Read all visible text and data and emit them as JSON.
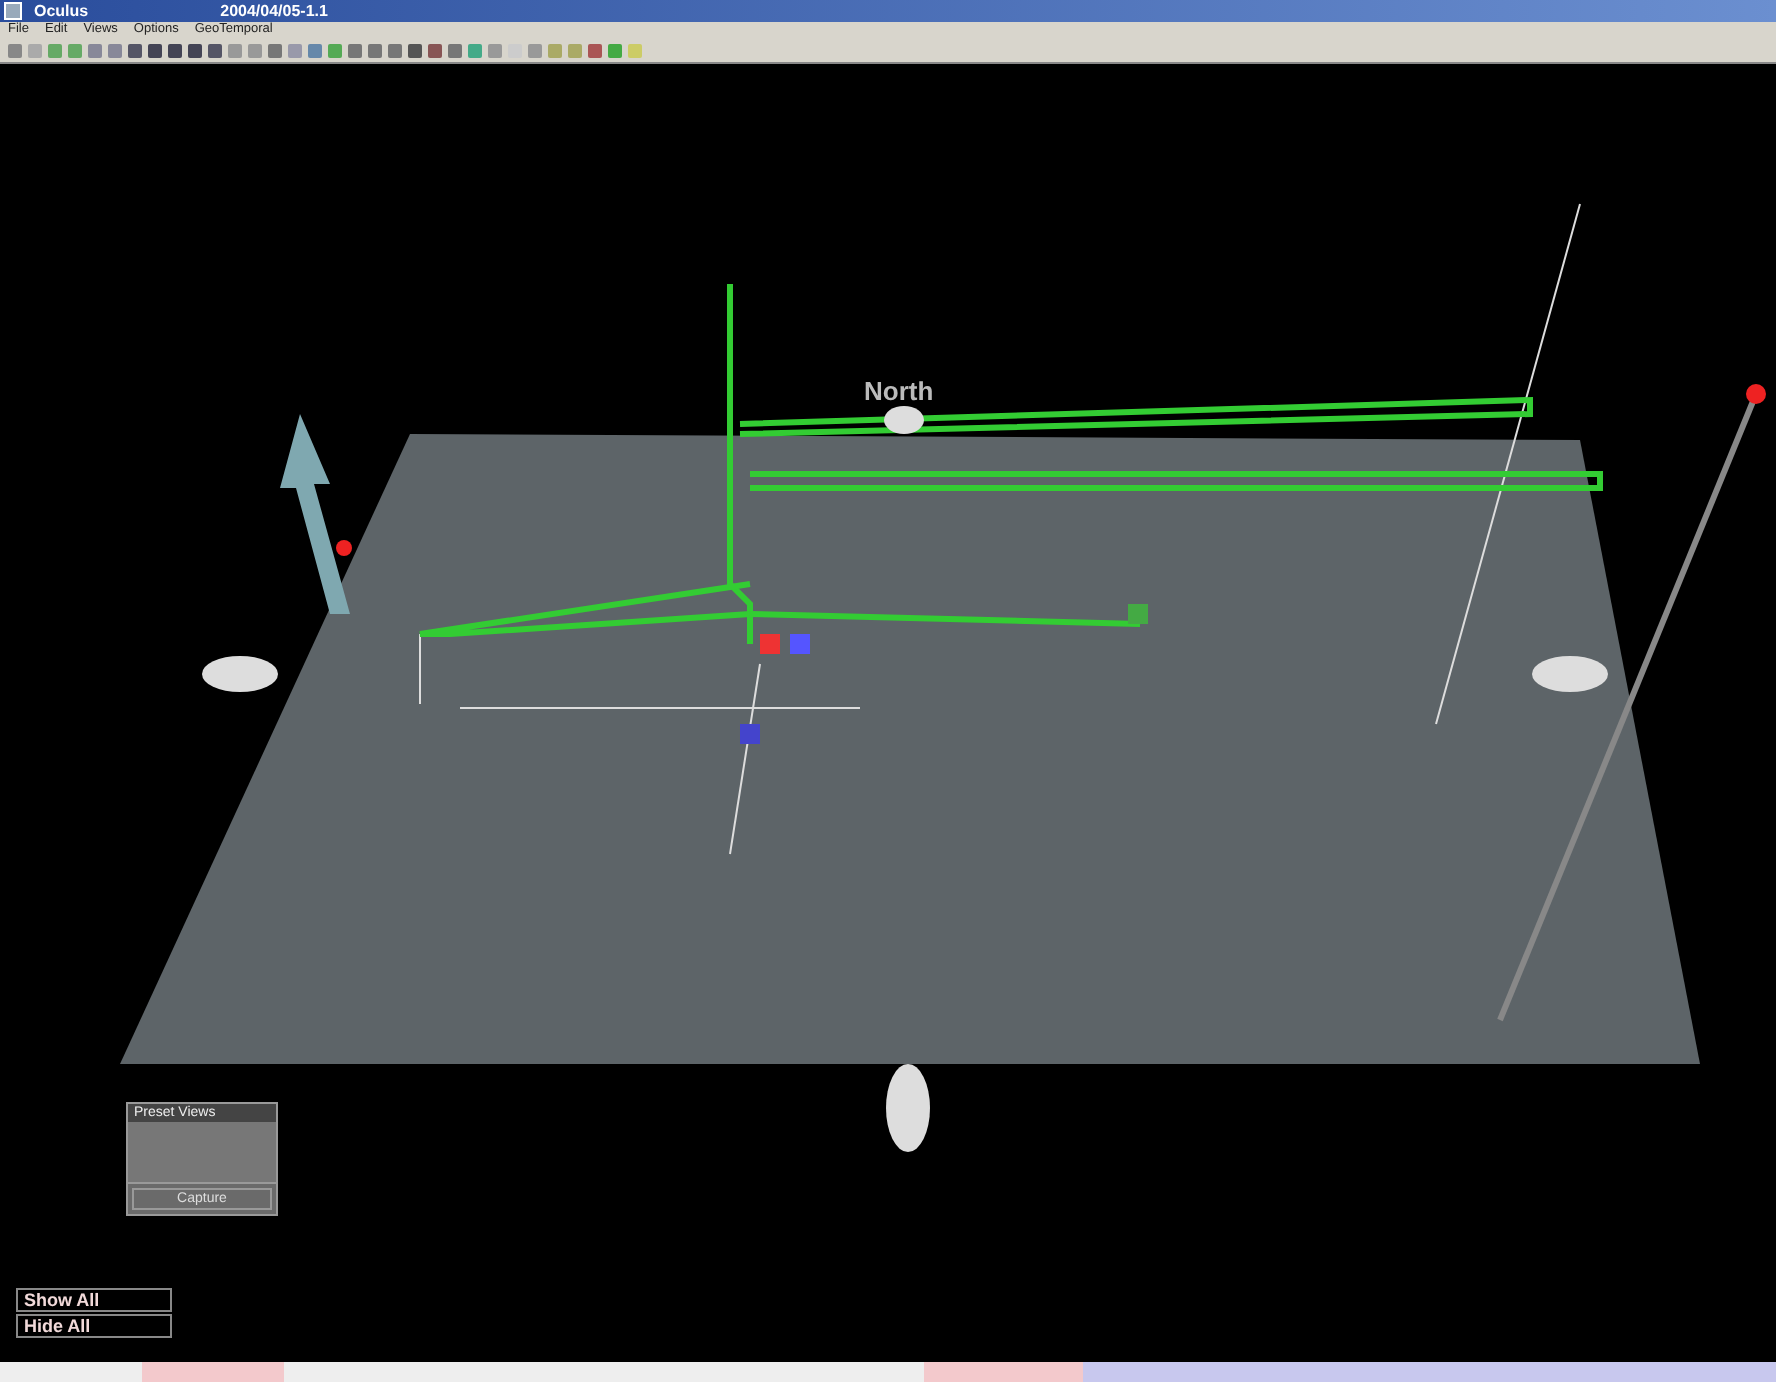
{
  "window": {
    "title": "Oculus",
    "document": "2004/04/05-1.1"
  },
  "menu": [
    "File",
    "Edit",
    "Views",
    "Options",
    "GeoTemporal"
  ],
  "scene": {
    "direction_label": "North"
  },
  "preset_views": {
    "title": "Preset Views",
    "capture": "Capture"
  },
  "buttons": [
    "Show All",
    "Hide All"
  ]
}
